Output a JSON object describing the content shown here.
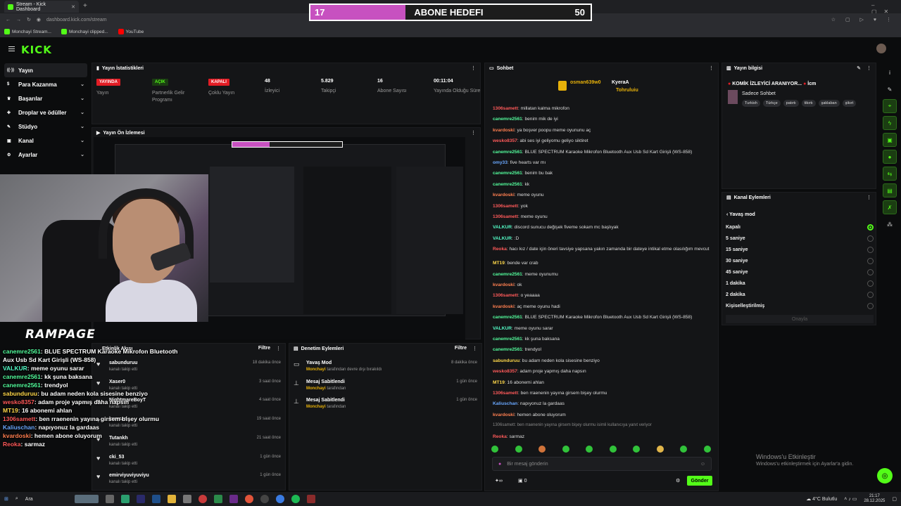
{
  "browser": {
    "tab_title": "Stream - Kick Dashboard",
    "url": "dashboard.kick.com/stream",
    "bookmarks": [
      "Monchayi Stream...",
      "Monchayi clipped...",
      "YouTube"
    ]
  },
  "subgoal": {
    "label": "ABONE HEDEFI",
    "current": "17",
    "target": "50",
    "progress": 0.34
  },
  "kick": {
    "logo": "KICK"
  },
  "sidebar": {
    "items": [
      {
        "label": "Yayın",
        "icon": "broadcast-icon",
        "active": true
      },
      {
        "label": "Para Kazanma",
        "icon": "dollar-icon"
      },
      {
        "label": "Başarılar",
        "icon": "trophy-icon"
      },
      {
        "label": "Droplar ve ödüller",
        "icon": "gift-icon"
      },
      {
        "label": "Stüdyo",
        "icon": "studio-icon"
      },
      {
        "label": "Kanal",
        "icon": "channel-icon"
      },
      {
        "label": "Ayarlar",
        "icon": "gear-icon"
      }
    ]
  },
  "stats": {
    "title": "Yayın İstatistikleri",
    "items": [
      {
        "value": "YAYINDA",
        "label": "Yayın",
        "color": "#e21d25"
      },
      {
        "value": "AÇIK",
        "label": "Partnerlik Gelir Programı",
        "color": "#53fc18"
      },
      {
        "value": "KAPALI",
        "label": "Çoklu Yayın",
        "color": "#e21d25"
      },
      {
        "value": "48",
        "label": "İzleyici"
      },
      {
        "value": "5.829",
        "label": "Takipçi"
      },
      {
        "value": "16",
        "label": "Abone Sayısı"
      },
      {
        "value": "00:11:04",
        "label": "Yayında Olduğu Süre"
      }
    ]
  },
  "preview": {
    "title": "Yayın Ön İzlemesi"
  },
  "activity": {
    "title": "Etkinlik Akışı",
    "filter": "Filtre",
    "rows": [
      {
        "name": "sabunduruu",
        "sub": "kanalı takip etti",
        "time": "18 dakika önce"
      },
      {
        "name": "Xaser0",
        "sub": "kanalı takip etti",
        "time": "3 saat önce"
      },
      {
        "name": "NightmareBoyT",
        "sub": "kanalı takip etti",
        "time": "4 saat önce"
      },
      {
        "name": "kurrsad",
        "sub": "kanalı takip etti",
        "time": "19 saat önce"
      },
      {
        "name": "Tutankh",
        "sub": "kanalı takip etti",
        "time": "21 saat önce"
      },
      {
        "name": "cki_53",
        "sub": "kanalı takip etti",
        "time": "1 gün önce"
      },
      {
        "name": "emirviyuviyuviyu",
        "sub": "kanalı takip etti",
        "time": "1 gün önce"
      }
    ]
  },
  "modlog": {
    "title": "Denetim Eylemleri",
    "filter": "Filtre",
    "rows": [
      {
        "name": "Yavaş Mod",
        "actor": "Monchayi",
        "sub": "tarafından devre dışı bırakıldı",
        "time": "8 dakika önce"
      },
      {
        "name": "Mesaj Sabitlendi",
        "actor": "Monchayi",
        "sub": "tarafından",
        "time": "1 gün önce"
      },
      {
        "name": "Mesaj Sabitlendi",
        "actor": "Monchayi",
        "sub": "tarafından",
        "time": "1 gün önce"
      }
    ]
  },
  "chat": {
    "title": "Sohbet",
    "pinned_users": [
      "osman639w0",
      "KyeraA",
      "Tohruluiu"
    ],
    "messages": [
      {
        "user": "1306samett",
        "color": "#ff5a5a",
        "text": "millatan kalma mikrofon"
      },
      {
        "user": "canemre2561",
        "color": "#53fc9c",
        "text": "benim mik de iyi"
      },
      {
        "user": "kvardoski",
        "color": "#ff7f50",
        "text": "ya boşver poopu meme oyununu aç"
      },
      {
        "user": "wesko8357",
        "color": "#ff5a5a",
        "text": "abi ses iyi geliyomu geliyo siktiret"
      },
      {
        "user": "canemre2561",
        "color": "#53fc9c",
        "text": "BLUE SPECTRUM Karaoke Mikrofon Bluetooth Aux Usb Sd Kart Girişli (WS-858)"
      },
      {
        "user": "omy33",
        "color": "#6aa8ff",
        "text": "five hearts var mı"
      },
      {
        "user": "canemre2561",
        "color": "#53fc9c",
        "text": "benim bu bak"
      },
      {
        "user": "canemre2561",
        "color": "#53fc9c",
        "text": "kk"
      },
      {
        "user": "kvardoski",
        "color": "#ff7f50",
        "text": "meme oyunu"
      },
      {
        "user": "1306samett",
        "color": "#ff5a5a",
        "text": "yok"
      },
      {
        "user": "1306samett",
        "color": "#ff5a5a",
        "text": "meme oyunu"
      },
      {
        "user": "VALKUR",
        "color": "#53fcc7",
        "text": "discord sunucu değişek fiveme sokam mc başlıyak"
      },
      {
        "user": "VALKUR",
        "color": "#53fcc7",
        "text": ":D"
      },
      {
        "user": "Reoka",
        "color": "#ff5a5a",
        "text": "hacı kız / date için öneri tavsiye yapsana yakın zamanda bir dateye intikal etme olasılığım mevcut"
      },
      {
        "user": "MT19",
        "color": "#ffd84a",
        "text": "bende var crab"
      },
      {
        "user": "canemre2561",
        "color": "#53fc9c",
        "text": "meme oyunumu"
      },
      {
        "user": "kvardoski",
        "color": "#ff7f50",
        "text": "ok"
      },
      {
        "user": "1306samett",
        "color": "#ff5a5a",
        "text": "o yeaaaa"
      },
      {
        "user": "kvardoski",
        "color": "#ff7f50",
        "text": "aç meme oyunu hadi"
      },
      {
        "user": "canemre2561",
        "color": "#53fc9c",
        "text": "BLUE SPECTRUM Karaoke Mikrofon Bluetooth Aux Usb Sd Kart Girişli (WS-858)"
      },
      {
        "user": "VALKUR",
        "color": "#53fcc7",
        "text": "meme oyunu sarar"
      },
      {
        "user": "canemre2561",
        "color": "#53fc9c",
        "text": "kk şuna baksana"
      },
      {
        "user": "canemre2561",
        "color": "#53fc9c",
        "text": "trendyol"
      },
      {
        "user": "sabunduruu",
        "color": "#ffd84a",
        "text": "bu adam neden kola sisesine benziyo"
      },
      {
        "user": "wesko8357",
        "color": "#ff5a5a",
        "text": "adam proje yapmış daha napsın"
      },
      {
        "user": "MT19",
        "color": "#ffd84a",
        "text": "16 abonemi ahlan"
      },
      {
        "user": "1306samett",
        "color": "#ff5a5a",
        "text": "ben rraenenin yayına girsem bişey olurmu"
      },
      {
        "user": "Kaliuschan",
        "color": "#6aa8ff",
        "text": "napıyonuz la gardaas"
      },
      {
        "user": "kvardoski",
        "color": "#ff7f50",
        "text": "hemen abone oluyorum"
      },
      {
        "user": "",
        "color": "#999999",
        "text": "1306samett: ben rraenenin yayına girsem bişey olurmu isimli kullanıcıya yanıt veriyor"
      },
      {
        "user": "Reoka",
        "color": "#ff5a5a",
        "text": "sarmaz"
      }
    ],
    "input_placeholder": "Bir mesaj gönderin",
    "count": "0",
    "send_label": "Gönder"
  },
  "info": {
    "title": "Yayın bilgisi",
    "stream_title": "KOMİK İZLEYİCİ ARANIYOR...",
    "suffix": "İcm",
    "category": "Sadece Sohbet",
    "tags": [
      "Turkish",
      "Türkçe",
      "patırtı",
      "tikırtı",
      "şaklaban",
      "şikırt"
    ]
  },
  "actions": {
    "title": "Kanal Eylemleri",
    "subtitle": "Yavaş mod",
    "options": [
      {
        "label": "Kapalı",
        "selected": true
      },
      {
        "label": "5 saniye"
      },
      {
        "label": "15 saniye"
      },
      {
        "label": "30 saniye"
      },
      {
        "label": "45 saniye"
      },
      {
        "label": "1 dakika"
      },
      {
        "label": "2 dakika"
      },
      {
        "label": "Kişiselleştirilmiş"
      }
    ],
    "confirm_label": "Onayla"
  },
  "windows_watermark": {
    "line1": "Windows'u Etkinleştir",
    "line2": "Windows'u etkinleştirmek için Ayarlar'a gidin."
  },
  "overlay": {
    "brand": "RAMPAGE",
    "chat": [
      {
        "user": "canemre2561",
        "color": "#53fc9c",
        "text": "BLUE SPECTRUM Karaoke Mikrofon Bluetooth Aux Usb Sd Kart Girişli (WS-858)"
      },
      {
        "user": "VALKUR",
        "color": "#53fcc7",
        "text": "meme oyunu sarar"
      },
      {
        "user": "canemre2561",
        "color": "#53fc9c",
        "text": "kk şuna baksana"
      },
      {
        "user": "canemre2561",
        "color": "#53fc9c",
        "text": "trendyol"
      },
      {
        "user": "sabunduruu",
        "color": "#ffd84a",
        "text": "bu adam neden kola sisesine benziyo"
      },
      {
        "user": "wesko8357",
        "color": "#ff5a5a",
        "text": "adam proje yapmış daha napsın"
      },
      {
        "user": "MT19",
        "color": "#ffd84a",
        "text": "16 abonemi ahlan"
      },
      {
        "user": "1306samett",
        "color": "#ff5a5a",
        "text": "ben rraenenin yayına girsem bişey olurmu"
      },
      {
        "user": "Kaliuschan",
        "color": "#6aa8ff",
        "text": "napıyonuz la gardaas"
      },
      {
        "user": "kvardoski",
        "color": "#ff7f50",
        "text": "hemen abone oluyorum"
      },
      {
        "user": "Reoka",
        "color": "#ff5a5a",
        "text": "sarmaz"
      }
    ]
  },
  "taskbar": {
    "search": "Ara",
    "weather": "4°C Bulutlu",
    "time": "21:17",
    "date": "28.12.2025"
  }
}
